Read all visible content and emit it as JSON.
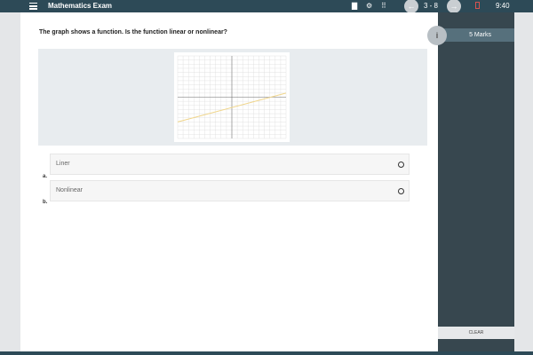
{
  "header": {
    "title": "Mathematics Exam",
    "counter": "3 - 8",
    "timer": "9:40",
    "prev_glyph": "←",
    "next_glyph": "→",
    "doc_glyph": "▇",
    "gear_glyph": "⚙",
    "grid_glyph": "⠿",
    "colors": {
      "bar": "#2d4a57",
      "flag": "#d9534f"
    }
  },
  "question": {
    "text": "The graph shows a function. Is the function linear or nonlinear?",
    "options": [
      {
        "letter": "a.",
        "label": "Liner"
      },
      {
        "letter": "b.",
        "label": "Nonlinear"
      }
    ]
  },
  "side": {
    "info_glyph": "i",
    "marks": "5 Marks",
    "clear_label": "CLEAR"
  },
  "chart_data": {
    "type": "line",
    "x_range": [
      -10,
      10
    ],
    "y_range": [
      -10,
      10
    ],
    "grid": true,
    "series": [
      {
        "x": [
          -10,
          10
        ],
        "y": [
          -6,
          1
        ],
        "color": "#f0d58a"
      }
    ]
  }
}
